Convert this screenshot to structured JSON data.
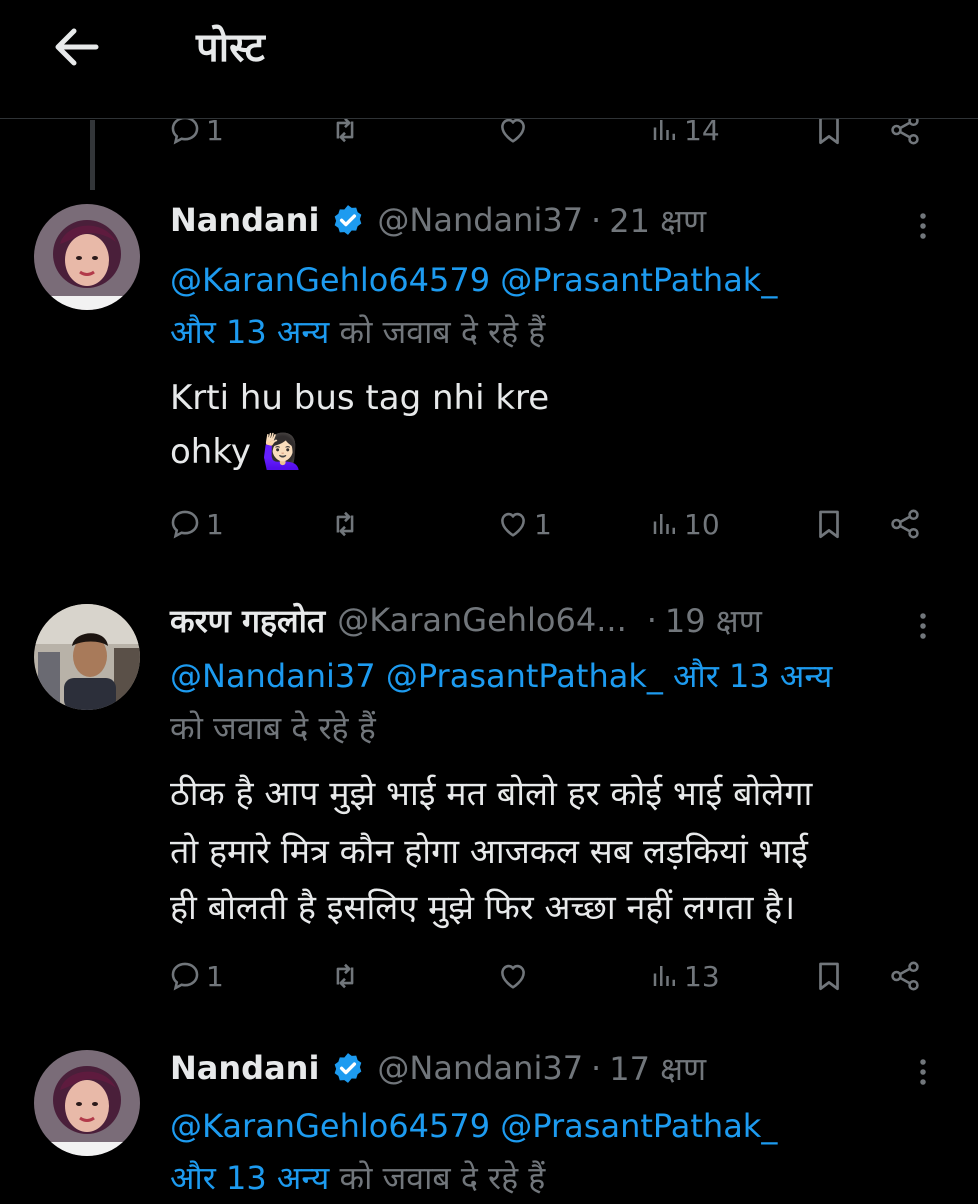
{
  "header": {
    "title": "पोस्ट"
  },
  "top_partial_actions": {
    "reply": "1",
    "repost": "",
    "like": "",
    "views": "14"
  },
  "tweets": [
    {
      "name": "Nandani",
      "handle": "@Nandani37",
      "time": "21 क्षण",
      "reply_to": {
        "line1": "@KaranGehlo64579 @PrasantPathak_",
        "line2_link": "और 13 अन्य",
        "line2_text": " को जवाब दे रहे हैं"
      },
      "text_lines": [
        "Krti hu bus tag nhi kre",
        "ohky 🙋🏻‍♀️"
      ],
      "actions": {
        "reply": "1",
        "repost": "",
        "like": "1",
        "views": "10"
      }
    },
    {
      "name": "करण गहलोत",
      "handle": "@KaranGehlo64...",
      "time": "19 क्षण",
      "reply_to": {
        "line1": "@Nandani37 @PrasantPathak_ और 13 अन्य",
        "line2_text": "को जवाब दे रहे हैं"
      },
      "text_lines": [
        "ठीक है आप मुझे भाई मत बोलो हर कोई भाई बोलेगा",
        "तो हमारे मित्र कौन होगा आजकल सब लड़कियां भाई",
        "ही बोलती है इसलिए मुझे फिर अच्छा नहीं लगता है।"
      ],
      "actions": {
        "reply": "1",
        "repost": "",
        "like": "",
        "views": "13"
      }
    },
    {
      "name": "Nandani",
      "handle": "@Nandani37",
      "time": "17 क्षण",
      "reply_to": {
        "line1": "@KaranGehlo64579 @PrasantPathak_",
        "line2_link": "और 13 अन्य",
        "line2_text": " को जवाब दे रहे हैं"
      }
    }
  ],
  "colors": {
    "background": "#000000",
    "text": "#e7e9ea",
    "muted": "#71767b",
    "link": "#1d9bf0",
    "verified": "#1d9bf0",
    "divider": "#2f3336"
  },
  "icons": [
    "back-arrow-icon",
    "reply-icon",
    "repost-icon",
    "like-icon",
    "views-icon",
    "bookmark-icon",
    "share-icon",
    "more-icon",
    "verified-badge-icon"
  ]
}
